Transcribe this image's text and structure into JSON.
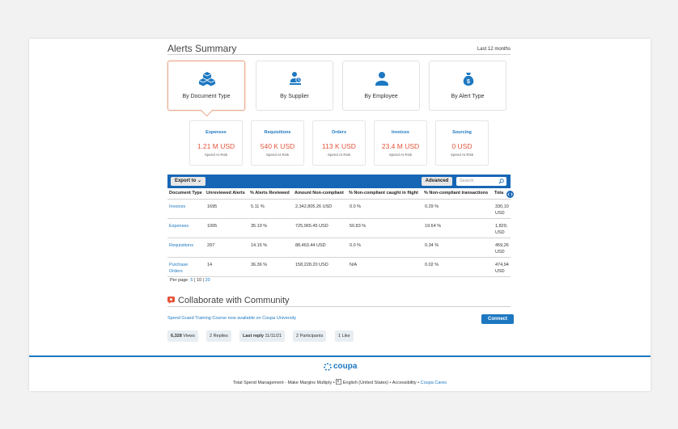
{
  "alerts": {
    "title": "Alerts Summary",
    "range": "Last 12 months",
    "cards": [
      {
        "label": "By Document Type",
        "icon": "cubes-icon"
      },
      {
        "label": "By Supplier",
        "icon": "supplier-icon"
      },
      {
        "label": "By Employee",
        "icon": "person-icon"
      },
      {
        "label": "By Alert Type",
        "icon": "money-bag-icon"
      }
    ],
    "stats": [
      {
        "title": "Expenses",
        "value": "1.21 M USD",
        "sub": "Spend At Risk"
      },
      {
        "title": "Requisitions",
        "value": "540 K USD",
        "sub": "Spend At Risk"
      },
      {
        "title": "Orders",
        "value": "113 K USD",
        "sub": "Spend At Risk"
      },
      {
        "title": "Invoices",
        "value": "23.4 M USD",
        "sub": "Spend At Risk"
      },
      {
        "title": "Sourcing",
        "value": "0 USD",
        "sub": "Spend At Risk"
      }
    ]
  },
  "toolbar": {
    "export_label": "Export to",
    "advanced_label": "Advanced",
    "search_placeholder": "Search"
  },
  "table": {
    "headers": [
      "Document Type",
      "Unreviewed Alerts",
      "% Alerts Reviewed",
      "Amount Non-compliant",
      "% Non-compliant caught in flight",
      "% Non-compliant transactions",
      "Tota"
    ],
    "rows": [
      {
        "type": "Invoices",
        "unreviewed": "1695",
        "reviewed": "5.11 %",
        "amount": "2,342,805.26 USD",
        "inflight": "0.0 %",
        "transactions": "0.29 %",
        "total": "330,10",
        "total_unit": "USD"
      },
      {
        "type": "Expenses",
        "unreviewed": "1005",
        "reviewed": "35.19 %",
        "amount": "725,965.45 USD",
        "inflight": "50.83 %",
        "transactions": "19.64 %",
        "total": "1,829,",
        "total_unit": "USD"
      },
      {
        "type": "Requisitions",
        "unreviewed": "297",
        "reviewed": "14.16 %",
        "amount": "88,463.44 USD",
        "inflight": "0.0 %",
        "transactions": "0.34 %",
        "total": "459,26",
        "total_unit": "USD"
      },
      {
        "type": "Purchase Orders",
        "unreviewed": "14",
        "reviewed": "36.36 %",
        "amount": "158,228.20 USD",
        "inflight": "N/A",
        "transactions": "0.02 %",
        "total": "474,94",
        "total_unit": "USD"
      }
    ]
  },
  "pager": {
    "label": "Per page",
    "options": [
      "5",
      "10",
      "20"
    ],
    "sep": "|"
  },
  "community": {
    "title": "Collaborate with Community",
    "course_link": "Spend Guard Training Course now available on Coupa University",
    "connect_label": "Connect",
    "views_count": "6,328",
    "views_label": "Views",
    "replies": "2 Replies",
    "last_reply_label": "Last reply",
    "last_reply_date": "11/11/21",
    "participants": "2 Participants",
    "likes": "1 Like"
  },
  "footer": {
    "logo_text": "coupa",
    "tagline": "Total Spend Management - Make Margins Multiply",
    "dot": "•",
    "language": "English (United States)",
    "accessibility": "Accessibility",
    "cares": "Coupa Cares"
  },
  "colors": {
    "accent": "#1d78c1",
    "toolbar": "#1766b5",
    "risk": "#e5543b",
    "active_card": "#e8a98a"
  }
}
